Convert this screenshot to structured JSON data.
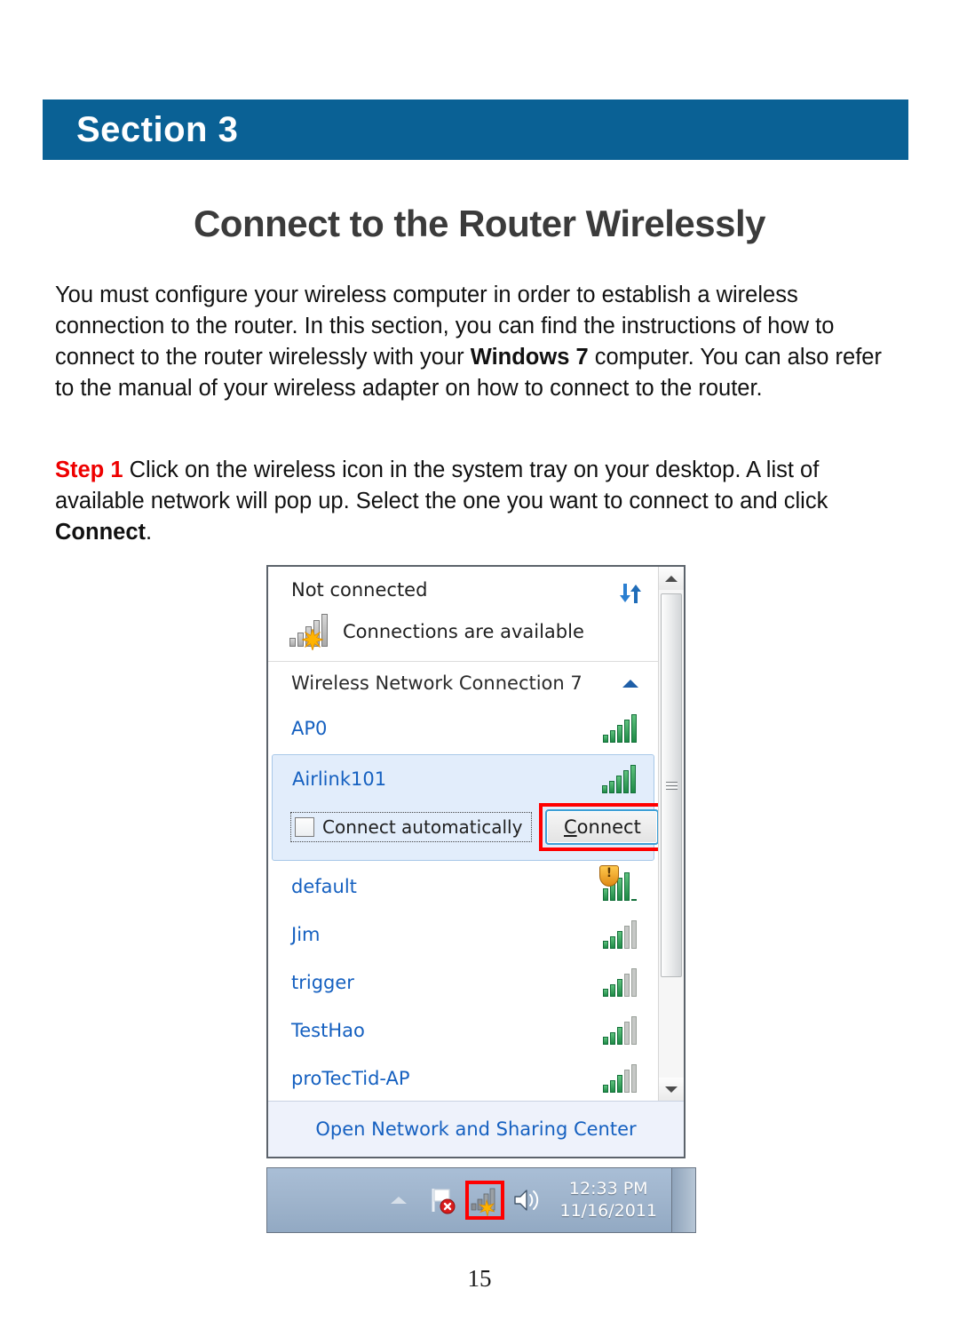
{
  "document": {
    "section_banner": "Section 3",
    "title": "Connect to the Router Wirelessly",
    "page_number": "15",
    "banner_color": "#0a6195",
    "step_color": "#ee0000"
  },
  "intro": {
    "part1": "You must configure your wireless computer in order to establish a wireless connection to the router. In this section, you can find the instructions of how to connect to the router wirelessly with your ",
    "bold1": "Windows 7",
    "part2": " computer. You can also refer to the manual of your wireless adapter on how to connect to the router."
  },
  "step": {
    "label": "Step 1",
    "part1": " Click on the wireless icon in the system tray on your desktop. A list of available network will pop up. Select the one you want to connect to and click ",
    "bold1": "Connect",
    "part2": "."
  },
  "popup": {
    "status_title": "Not connected",
    "status_message": "Connections are available",
    "adapter_name": "Wireless Network Connection 7",
    "footer_link": "Open Network and Sharing Center",
    "selected_network": "Airlink101",
    "auto_connect_label": "Connect automatically",
    "auto_connect_checked": false,
    "connect_button": "Connect",
    "networks": [
      {
        "name": "AP0",
        "bars": 5,
        "secured": true,
        "selected": false
      },
      {
        "name": "Airlink101",
        "bars": 5,
        "secured": true,
        "selected": true
      },
      {
        "name": "default",
        "bars": 5,
        "secured": false,
        "selected": false
      },
      {
        "name": "Jim",
        "bars": 3,
        "secured": true,
        "selected": false
      },
      {
        "name": "trigger",
        "bars": 3,
        "secured": true,
        "selected": false
      },
      {
        "name": "TestHao",
        "bars": 3,
        "secured": true,
        "selected": false
      },
      {
        "name": "proTecTid-AP",
        "bars": 3,
        "secured": true,
        "selected": false
      }
    ]
  },
  "taskbar": {
    "time": "12:33 PM",
    "date": "11/16/2011"
  }
}
